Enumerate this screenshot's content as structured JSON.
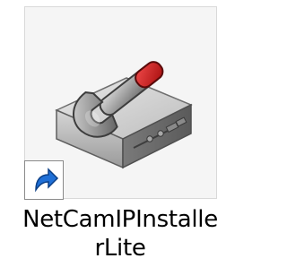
{
  "shortcut": {
    "label_line1": "NetCamIPInstalle",
    "label_line2": "rLite",
    "icon": "wrench-on-hard-drive-icon",
    "overlay_icon": "shortcut-arrow-icon"
  }
}
